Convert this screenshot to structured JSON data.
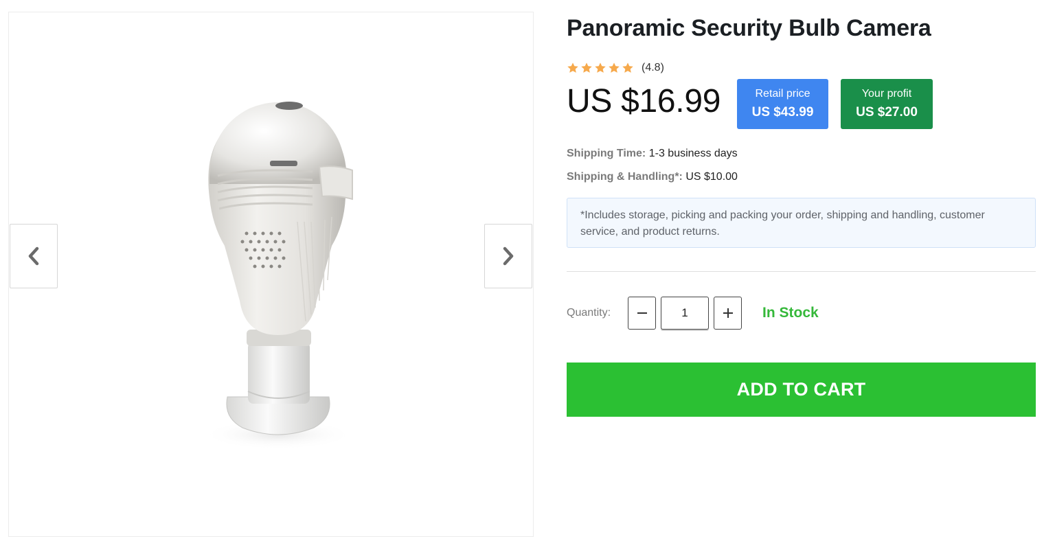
{
  "product": {
    "title": "Panoramic Security Bulb Camera",
    "rating_value": "(4.8)",
    "rating": 4.8,
    "rating_max": 5,
    "price": "US $16.99",
    "image_name": "bulb-camera-photo"
  },
  "badges": {
    "retail_label": "Retail price",
    "retail_value": "US $43.99",
    "profit_label": "Your profit",
    "profit_value": "US $27.00"
  },
  "shipping": {
    "time_label": "Shipping Time:",
    "time_value": "1-3 business days",
    "handling_label": "Shipping & Handling*:",
    "handling_value": "US $10.00",
    "notice": "*Includes storage, picking and packing your order, shipping and handling, customer service, and product returns."
  },
  "quantity": {
    "label": "Quantity:",
    "value": "1",
    "stock": "In Stock"
  },
  "cart": {
    "label": "ADD TO CART"
  },
  "icons": {
    "prev": "chevron-left-icon",
    "next": "chevron-right-icon",
    "minus": "minus-icon",
    "plus": "plus-icon",
    "star": "star-icon"
  },
  "colors": {
    "star": "#f6a94c",
    "retail_badge": "#3f86f0",
    "profit_badge": "#1a8f4a",
    "in_stock": "#35b83a",
    "cart_button": "#2bc033",
    "notice_bg": "#f3f8fe"
  }
}
